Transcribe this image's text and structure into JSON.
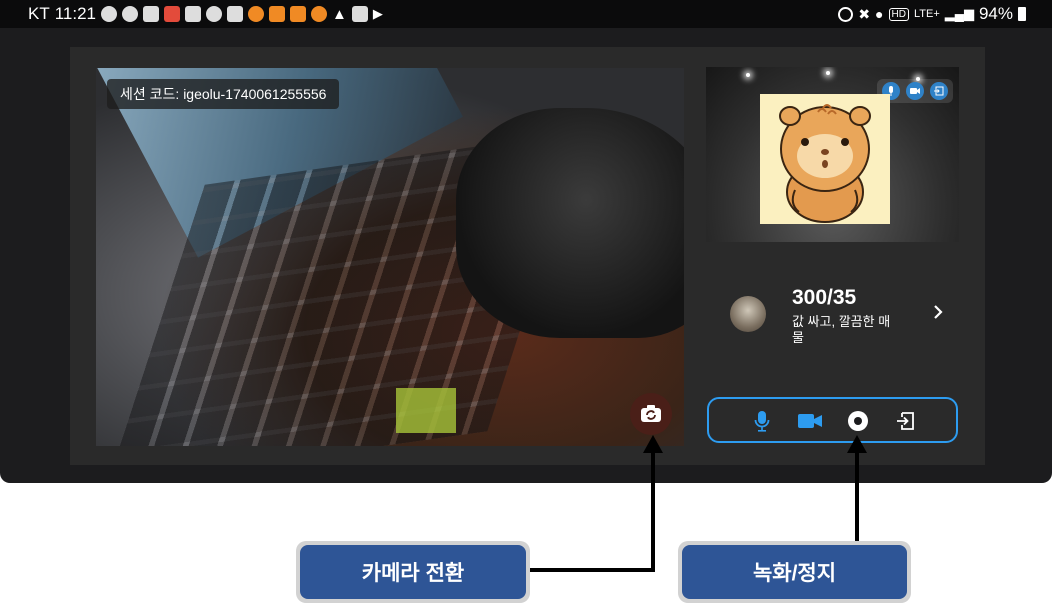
{
  "status_bar": {
    "carrier": "KT",
    "time": "11:21",
    "network": "LTE+",
    "battery": "94%"
  },
  "main_video": {
    "session_label": "세션 코드: igeolu-1740061255556",
    "camera_switch_icon": "camera-switch-icon"
  },
  "listing": {
    "price": "300/35",
    "description": "값 싸고, 깔끔한 매물"
  },
  "controls": [
    {
      "name": "mic-icon",
      "color": "#2d9cf0"
    },
    {
      "name": "video-camera-icon",
      "color": "#2d9cf0"
    },
    {
      "name": "record-icon",
      "color": "#ffffff"
    },
    {
      "name": "exit-icon",
      "color": "#ffffff"
    }
  ],
  "callouts": {
    "camera_switch": "카메라 전환",
    "record_stop": "녹화/정지"
  },
  "colors": {
    "accent": "#2d9cf0",
    "callout_fill": "#2e5596",
    "callout_border": "#d2d2d2",
    "panel_bg": "#2a2a2a"
  }
}
